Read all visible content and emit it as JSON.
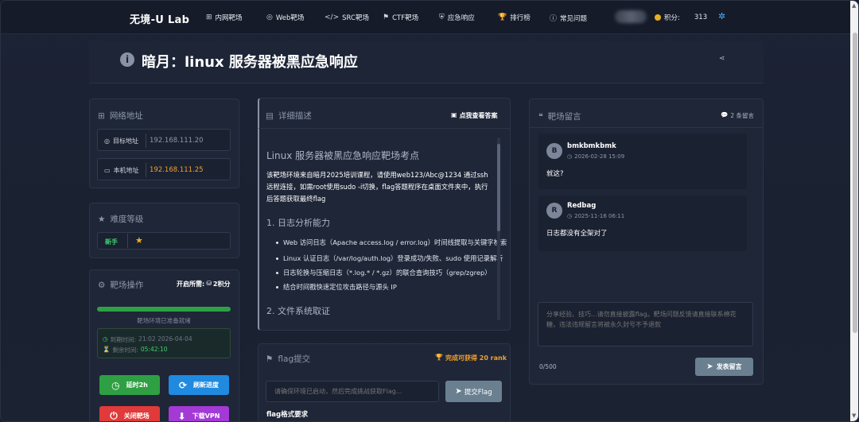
{
  "nav": {
    "brand": "无境-U Lab",
    "items": [
      {
        "label": "内网靶场",
        "icon": "network-icon"
      },
      {
        "label": "Web靶场",
        "icon": "globe-icon"
      },
      {
        "label": "SRC靶场",
        "icon": "code-icon"
      },
      {
        "label": "CTF靶场",
        "icon": "flag-icon"
      },
      {
        "label": "应急响应",
        "icon": "shield-icon"
      },
      {
        "label": "排行榜",
        "icon": "trophy-icon"
      },
      {
        "label": "常见问题",
        "icon": "info-icon"
      }
    ],
    "points_label": "积分:",
    "points_value": "313"
  },
  "page": {
    "title": "暗月：linux 服务器被黑应急响应"
  },
  "network": {
    "heading": "网络地址",
    "target_label": "目标地址",
    "target_value": "192.168.111.20",
    "local_label": "本机地址",
    "local_value": "192.168.111.25"
  },
  "difficulty": {
    "heading": "难度等级",
    "level": "新手"
  },
  "ops": {
    "heading": "靶场操作",
    "cost_label": "开启所需:",
    "cost_value": "2积分",
    "progress": 1.0,
    "status": "靶场环境已准备就绪",
    "expire_label": "到期时间:",
    "expire_value": "21:02 2026-04-04",
    "remain_label": "剩余时间:",
    "remain_value": "05:42:10",
    "extend_label": "延时2h",
    "refresh_label": "刷新进度",
    "close_label": "关闭靶场",
    "vpn_label": "下载VPN"
  },
  "desc": {
    "heading": "详细描述",
    "answer_link": "点我查看答案",
    "h1": "Linux 服务器被黑应急响应靶场考点",
    "intro": "该靶场环境来自暗月2025培训课程，请使用web123/Abc@1234 通过ssh远程连接，如需root使用sudo -i切换，flag答题程序在桌面文件夹中，执行后答题获取最终flag",
    "h2a": "1. 日志分析能力",
    "bullets": [
      "Web 访问日志（Apache access.log / error.log）时间线提取与关键字检索",
      "Linux 认证日志（/var/log/auth.log）登录成功/失败、sudo 使用记录解析",
      "日志轮换与压缩日志（*.log.* / *.gz）的联合查询技巧（grep/zgrep）",
      "结合时间戳快速定位攻击路径与源头 IP"
    ],
    "h2b": "2. 文件系统取证"
  },
  "flag": {
    "heading": "flag提交",
    "reward": "完成可获得 20 rank",
    "placeholder": "请确保环境已启动，然后完成挑战获取Flag...",
    "submit_label": "提交Flag",
    "format_label": "flag格式要求"
  },
  "comments": {
    "heading": "靶场留言",
    "count": "2 条留言",
    "items": [
      {
        "avatar": "B",
        "user": "bmkbmkbmk",
        "time": "2026-02-28 15:09",
        "text": "就这?"
      },
      {
        "avatar": "R",
        "user": "Redbag",
        "time": "2025-11-16 06:11",
        "text": "日志都没有全架对了"
      }
    ],
    "placeholder": "分享经验、技巧...请勿直接披露flag。靶场问题反馈请直接联系棉花糖，违法违规留言将被永久封号不予退款",
    "char_count": "0/500",
    "submit_label": "发表留言"
  },
  "colors": {
    "accent_green": "#2ea043",
    "accent_blue": "#1f8ae0",
    "accent_red": "#e03a3a",
    "accent_purple": "#a33ad6",
    "ip_orange": "#f0a030"
  }
}
